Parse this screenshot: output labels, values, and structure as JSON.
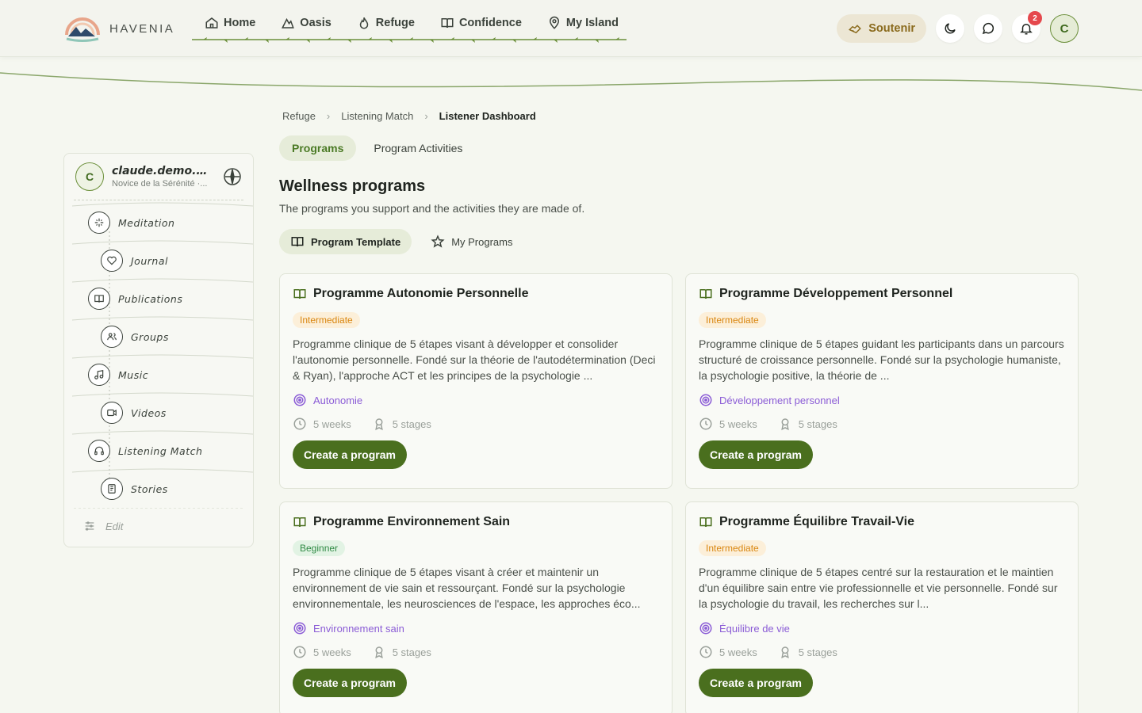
{
  "brand": {
    "name": "HAVENIA"
  },
  "nav": [
    {
      "label": "Home",
      "icon": "home-icon"
    },
    {
      "label": "Oasis",
      "icon": "mountain-icon"
    },
    {
      "label": "Refuge",
      "icon": "flame-icon"
    },
    {
      "label": "Confidence",
      "icon": "book-icon"
    },
    {
      "label": "My Island",
      "icon": "map-pin-icon"
    }
  ],
  "header": {
    "support_label": "Soutenir",
    "notifications_count": "2",
    "avatar_initial": "C"
  },
  "sidebar": {
    "user": {
      "initial": "C",
      "name": "claude.demo.des...",
      "subtitle": "Novice de la Sérénité ·..."
    },
    "items": [
      {
        "label": "Meditation",
        "icon": "sparkles-icon"
      },
      {
        "label": "Journal",
        "icon": "heart-icon"
      },
      {
        "label": "Publications",
        "icon": "book-open-icon"
      },
      {
        "label": "Groups",
        "icon": "users-icon"
      },
      {
        "label": "Music",
        "icon": "music-icon"
      },
      {
        "label": "Videos",
        "icon": "video-icon"
      },
      {
        "label": "Listening Match",
        "icon": "headphones-icon"
      },
      {
        "label": "Stories",
        "icon": "book-stories-icon"
      }
    ],
    "edit_label": "Edit"
  },
  "breadcrumb": [
    "Refuge",
    "Listening Match",
    "Listener Dashboard"
  ],
  "tabs": [
    "Programs",
    "Program Activities"
  ],
  "page": {
    "title": "Wellness programs",
    "subtitle": "The programs you support and the activities they are made of."
  },
  "subtabs": [
    "Program Template",
    "My Programs"
  ],
  "cards": [
    {
      "title": "Programme Autonomie Personnelle",
      "level": "Intermediate",
      "description": "Programme clinique de 5 étapes visant à développer et consolider l'autonomie personnelle. Fondé sur la théorie de l'autodétermination (Deci & Ryan), l'approche ACT et les principes de la psychologie ...",
      "domain": "Autonomie",
      "duration": "5 weeks",
      "stages": "5 stages",
      "button": "Create a program"
    },
    {
      "title": "Programme Développement Personnel",
      "level": "Intermediate",
      "description": "Programme clinique de 5 étapes guidant les participants dans un parcours structuré de croissance personnelle. Fondé sur la psychologie humaniste, la psychologie positive, la théorie de ...",
      "domain": "Développement personnel",
      "duration": "5 weeks",
      "stages": "5 stages",
      "button": "Create a program"
    },
    {
      "title": "Programme Environnement Sain",
      "level": "Beginner",
      "description": "Programme clinique de 5 étapes visant à créer et maintenir un environnement de vie sain et ressourçant. Fondé sur la psychologie environnementale, les neurosciences de l'espace, les approches éco...",
      "domain": "Environnement sain",
      "duration": "5 weeks",
      "stages": "5 stages",
      "button": "Create a program"
    },
    {
      "title": "Programme Équilibre Travail-Vie",
      "level": "Intermediate",
      "description": "Programme clinique de 5 étapes centré sur la restauration et le maintien d'un équilibre sain entre vie professionnelle et vie personnelle. Fondé sur la psychologie du travail, les recherches sur l...",
      "domain": "Équilibre de vie",
      "duration": "5 weeks",
      "stages": "5 stages",
      "button": "Create a program"
    }
  ],
  "colors": {
    "accent": "#4a6f1e",
    "domain": "#8b5cd6",
    "intermediate": "#d9860f",
    "beginner": "#2f8a44"
  }
}
